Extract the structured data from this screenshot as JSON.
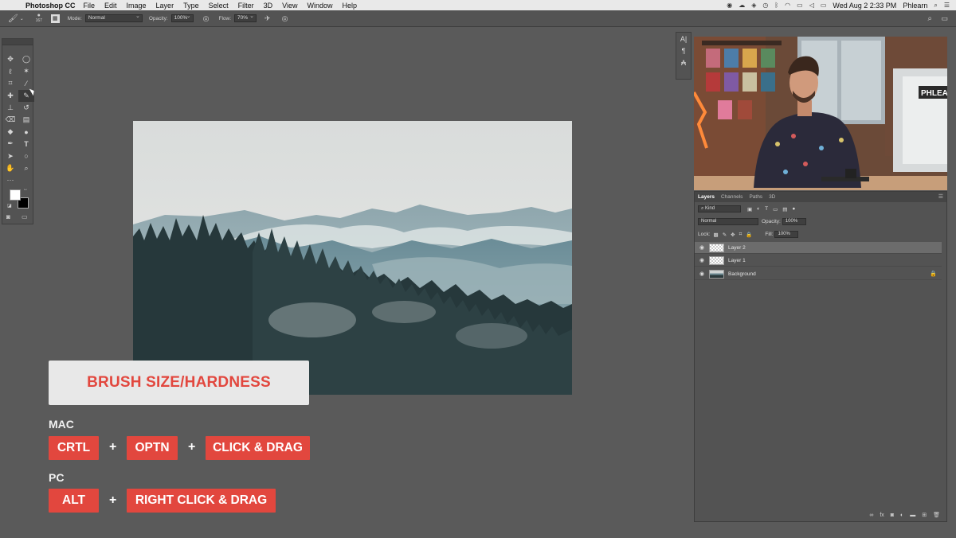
{
  "menubar": {
    "app_name": "Photoshop CC",
    "menus": [
      "File",
      "Edit",
      "Image",
      "Layer",
      "Type",
      "Select",
      "Filter",
      "3D",
      "View",
      "Window",
      "Help"
    ],
    "datetime": "Wed Aug 2  2:33 PM",
    "user": "Phlearn"
  },
  "options_bar": {
    "brush_size": "167",
    "mode_label": "Mode:",
    "mode_value": "Normal",
    "opacity_label": "Opacity:",
    "opacity_value": "100%",
    "flow_label": "Flow:",
    "flow_value": "70%"
  },
  "overlay": {
    "title": "BRUSH SIZE/HARDNESS",
    "mac_label": "MAC",
    "mac_keys": [
      "CRTL",
      "OPTN",
      "CLICK & DRAG"
    ],
    "pc_label": "PC",
    "pc_keys": [
      "ALT",
      "RIGHT CLICK & DRAG"
    ],
    "plus": "+"
  },
  "webcam": {
    "sign_text": "PHLEA"
  },
  "layers_panel": {
    "tabs": [
      "Layers",
      "Channels",
      "Paths",
      "3D"
    ],
    "filter_label": "Kind",
    "blend_mode": "Normal",
    "opacity_label": "Opacity:",
    "opacity_value": "100%",
    "lock_label": "Lock:",
    "fill_label": "Fill:",
    "fill_value": "100%",
    "layers": [
      {
        "name": "Layer 2",
        "selected": true
      },
      {
        "name": "Layer 1",
        "selected": false
      },
      {
        "name": "Background",
        "selected": false,
        "locked": true
      }
    ]
  },
  "colors": {
    "accent_red": "#e2473e",
    "workspace": "#5a5a5a",
    "panel": "#535353"
  }
}
